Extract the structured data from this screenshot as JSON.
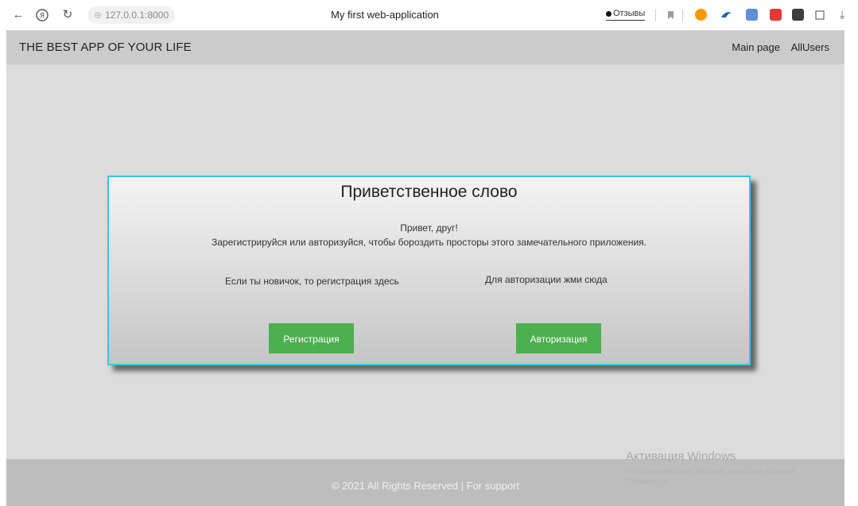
{
  "browser": {
    "url": "127.0.0.1:8000",
    "tab_title": "My first web-application",
    "feedback_label": "Отзывы",
    "icons": [
      "back-arrow-icon",
      "yandex-icon",
      "reload-icon",
      "globe-icon",
      "bookmark-icon",
      "download-icon"
    ]
  },
  "header": {
    "brand": "THE BEST APP OF YOUR LIFE",
    "nav": [
      "Main page",
      "AllUsers"
    ]
  },
  "card": {
    "title": "Приветственное слово",
    "greeting_line1": "Привет, друг!",
    "greeting_line2": "Зарегистрируйся или авторизуйся, чтобы бороздить просторы этого замечательного приложения.",
    "left_text": "Если ты новичок, то регистрация здесь",
    "right_text": "Для авторизации жми сюда",
    "register_button": "Регистрация",
    "login_button": "Авторизация"
  },
  "footer": {
    "text": "© 2021 All Rights Reserved | For support"
  },
  "watermark": {
    "title": "Активация Windows",
    "subtitle": "Чтобы активировать Windows, перейдите в раздел \"Параметры\"."
  },
  "colors": {
    "accent_border": "#38c4ea",
    "button": "#4caf50",
    "header_bg": "#cbcbcb",
    "main_bg": "#dcdcdc",
    "footer_bg": "#bdbdbd"
  }
}
